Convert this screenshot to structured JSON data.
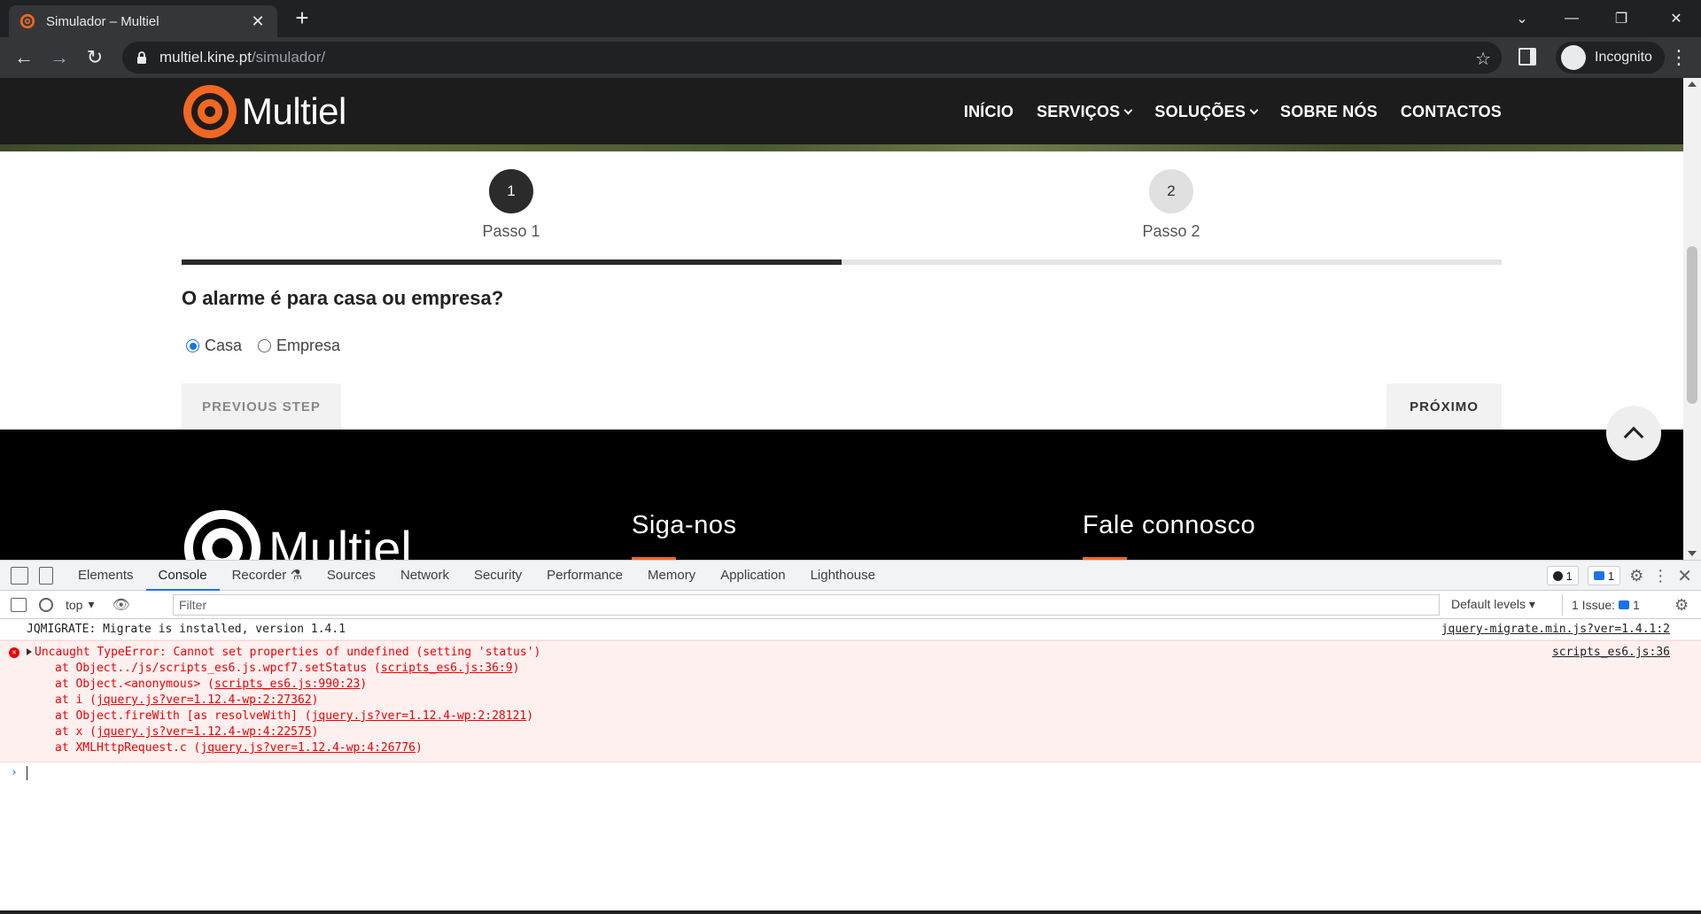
{
  "browser": {
    "tab_title": "Simulador – Multiel",
    "url_host": "multiel.kine.pt",
    "url_path": "/simulador/",
    "incognito_label": "Incognito"
  },
  "site": {
    "logo_text": "Multiel",
    "nav": [
      "INÍCIO",
      "SERVIÇOS",
      "SOLUÇÕES",
      "SOBRE NÓS",
      "CONTACTOS"
    ],
    "steps": [
      {
        "number": "1",
        "label": "Passo 1"
      },
      {
        "number": "2",
        "label": "Passo 2"
      }
    ],
    "progress_fraction": 0.5,
    "question": "O alarme é para casa ou empresa?",
    "options": [
      {
        "label": "Casa",
        "checked": true
      },
      {
        "label": "Empresa",
        "checked": false
      }
    ],
    "prev_button": "PREVIOUS STEP",
    "next_button": "PRÓXIMO",
    "footer_logo_text": "Multiel",
    "footer_follow": "Siga-nos",
    "footer_contact": "Fale connosco",
    "accent_color": "#f26722"
  },
  "devtools": {
    "tabs": [
      "Elements",
      "Console",
      "Recorder",
      "Sources",
      "Network",
      "Security",
      "Performance",
      "Memory",
      "Application",
      "Lighthouse"
    ],
    "active_tab": "Console",
    "error_count": "1",
    "message_count": "1",
    "context": "top",
    "filter_placeholder": "Filter",
    "levels": "Default levels",
    "issues_label": "1 Issue:",
    "issues_count": "1",
    "log_message": "JQMIGRATE: Migrate is installed, version 1.4.1",
    "log_source": "jquery-migrate.min.js?ver=1.4.1:2",
    "error_message": "Uncaught TypeError: Cannot set properties of undefined (setting 'status')",
    "error_source": "scripts_es6.js:36",
    "stack": [
      {
        "text": "at Object../js/scripts_es6.js.wpcf7.setStatus (",
        "link": "scripts_es6.js:36:9",
        "end": ")"
      },
      {
        "text": "at Object.<anonymous> (",
        "link": "scripts_es6.js:990:23",
        "end": ")"
      },
      {
        "text": "at i (",
        "link": "jquery.js?ver=1.12.4-wp:2:27362",
        "end": ")"
      },
      {
        "text": "at Object.fireWith [as resolveWith] (",
        "link": "jquery.js?ver=1.12.4-wp:2:28121",
        "end": ")"
      },
      {
        "text": "at x (",
        "link": "jquery.js?ver=1.12.4-wp:4:22575",
        "end": ")"
      },
      {
        "text": "at XMLHttpRequest.c (",
        "link": "jquery.js?ver=1.12.4-wp:4:26776",
        "end": ")"
      }
    ]
  }
}
